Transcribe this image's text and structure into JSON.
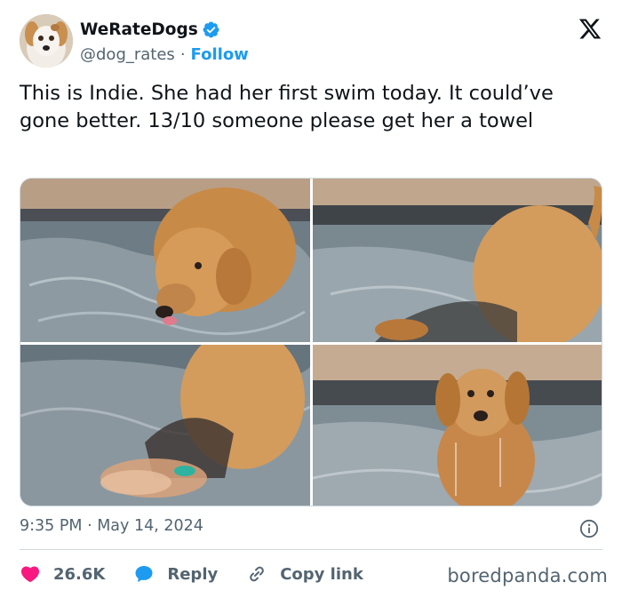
{
  "tweet": {
    "author": {
      "display_name": "WeRateDogs",
      "handle": "@dog_rates",
      "separator": "·",
      "follow_label": "Follow",
      "verified": true
    },
    "text": "This is Indie. She had her first swim today. It could’ve gone better. 13/10 someone please get her a towel",
    "media": [
      {
        "icon": "photo-puppy-licking-water"
      },
      {
        "icon": "photo-puppy-walking-in-pool"
      },
      {
        "icon": "photo-puppy-splashing"
      },
      {
        "icon": "photo-wet-puppy-facing-camera"
      }
    ],
    "timestamp": "9:35 PM · May 14, 2024",
    "likes": "26.6K",
    "reply_label": "Reply",
    "copy_link_label": "Copy link"
  },
  "watermark": "boredpanda.com",
  "colors": {
    "accent": "#1d9bf0",
    "like": "#f91880",
    "text": "#0f1419",
    "muted": "#536471"
  }
}
